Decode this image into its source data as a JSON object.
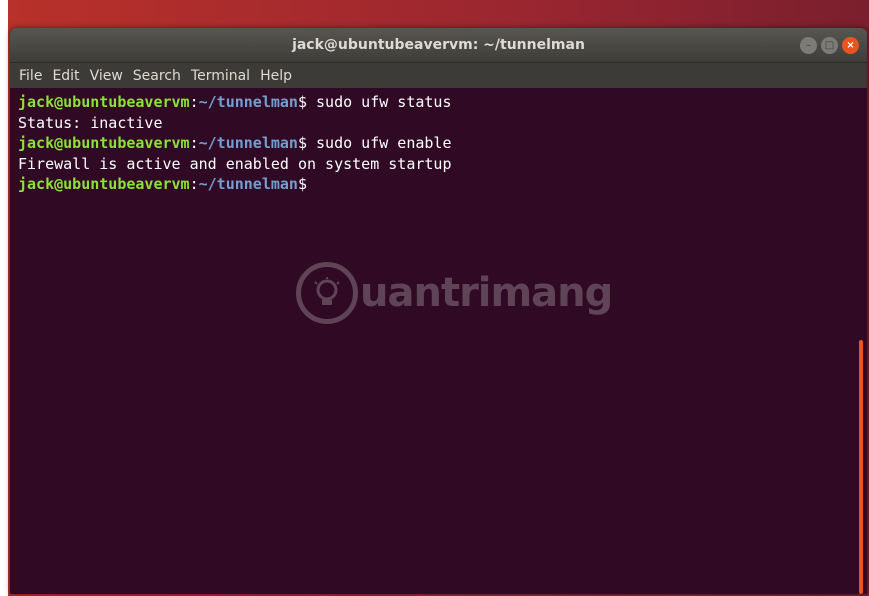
{
  "window": {
    "title": "jack@ubuntubeavervm: ~/tunnelman",
    "controls": {
      "minimize_icon": "minimize-icon",
      "maximize_icon": "maximize-icon",
      "close_icon": "close-icon",
      "close_glyph": "×",
      "minimize_glyph": "–",
      "maximize_glyph": "□"
    }
  },
  "menubar": {
    "items": [
      "File",
      "Edit",
      "View",
      "Search",
      "Terminal",
      "Help"
    ]
  },
  "terminal": {
    "lines": [
      {
        "user": "jack@ubuntubeavervm",
        "sep": ":",
        "path": "~/tunnelman",
        "prompt": "$",
        "command": " sudo ufw status"
      },
      {
        "output": "Status: inactive"
      },
      {
        "user": "jack@ubuntubeavervm",
        "sep": ":",
        "path": "~/tunnelman",
        "prompt": "$",
        "command": " sudo ufw enable"
      },
      {
        "output": "Firewall is active and enabled on system startup"
      },
      {
        "user": "jack@ubuntubeavervm",
        "sep": ":",
        "path": "~/tunnelman",
        "prompt": "$",
        "command": ""
      }
    ]
  },
  "watermark": {
    "text": "uantrimang",
    "icon": "lightbulb-icon"
  },
  "colors": {
    "terminal_bg": "#300a24",
    "user_green": "#8ae234",
    "path_blue": "#729fcf",
    "accent_orange": "#e95420"
  }
}
